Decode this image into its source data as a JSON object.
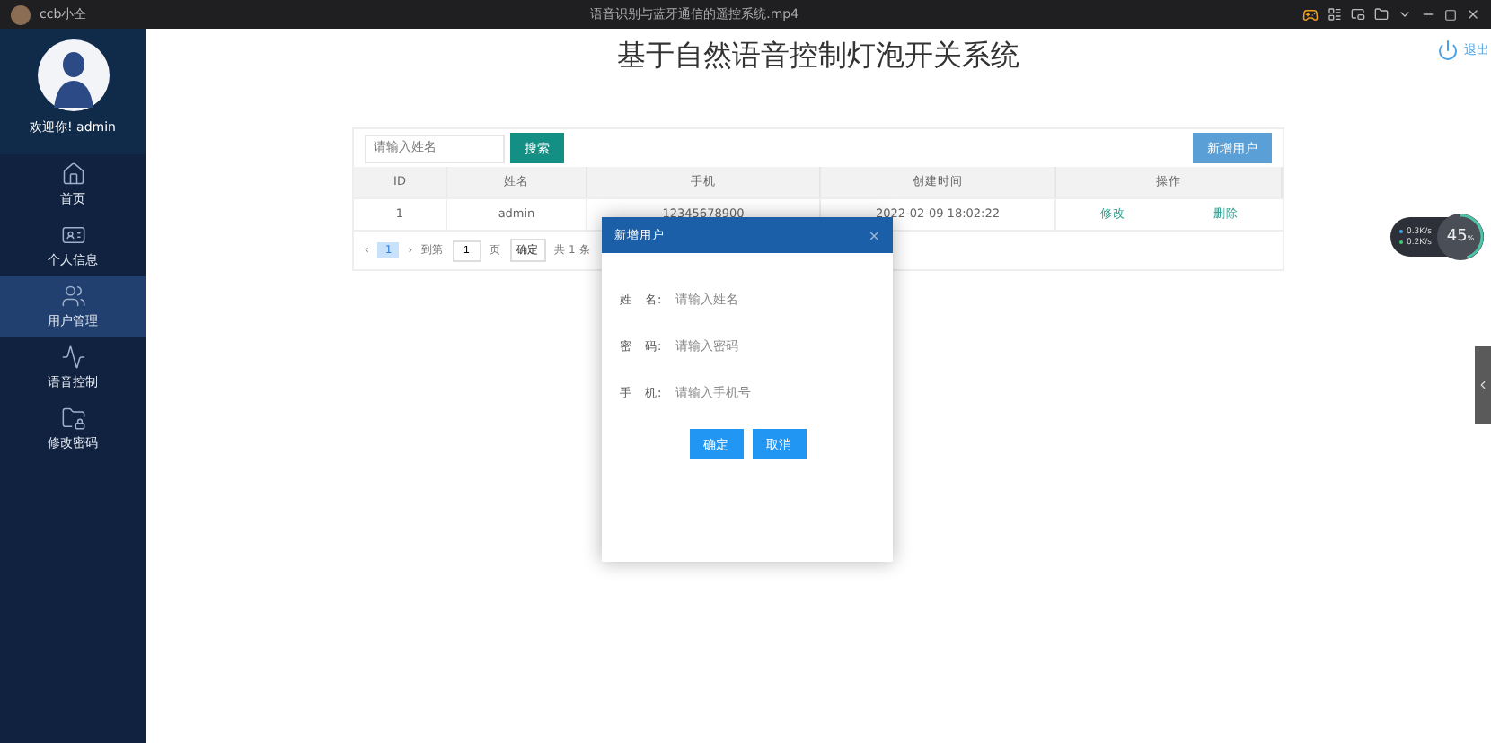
{
  "player": {
    "user": "ccb小仝",
    "title": "语音识别与蓝牙通信的遥控系统.mp4"
  },
  "app": {
    "title": "基于自然语音控制灯泡开关系统",
    "logout": "退出",
    "welcome": "欢迎你! admin"
  },
  "sidebar": {
    "items": [
      {
        "label": "首页",
        "selected": false
      },
      {
        "label": "个人信息",
        "selected": false
      },
      {
        "label": "用户管理",
        "selected": true
      },
      {
        "label": "语音控制",
        "selected": false
      },
      {
        "label": "修改密码",
        "selected": false
      }
    ]
  },
  "search": {
    "placeholder": "请输入姓名",
    "button": "搜索"
  },
  "add_button": "新增用户",
  "table": {
    "columns": [
      "ID",
      "姓名",
      "手机",
      "创建时间",
      "操作"
    ],
    "rows": [
      {
        "id": "1",
        "name": "admin",
        "phone": "12345678900",
        "created": "2022-02-09 18:02:22",
        "actions": [
          "修改",
          "删除"
        ]
      }
    ]
  },
  "pagination": {
    "prev": "‹",
    "pages": [
      {
        "label": "1",
        "selected": true
      }
    ],
    "next": "›",
    "goto": "到第",
    "page_value": "1",
    "page_unit": "页",
    "confirm": "确定",
    "total": "共 1 条"
  },
  "dialog": {
    "title": "新增用户",
    "close": "×",
    "fields": [
      {
        "label": "姓　名:",
        "placeholder": "请输入姓名"
      },
      {
        "label": "密　码:",
        "placeholder": "请输入密码"
      },
      {
        "label": "手　机:",
        "placeholder": "请输入手机号"
      }
    ],
    "buttons": [
      "确定",
      "取消"
    ]
  },
  "net_widget": {
    "up": "0.3",
    "up_unit": "K/s",
    "down": "0.2",
    "down_unit": "K/s",
    "percent": "45",
    "percent_unit": "%",
    "level": 0.45
  }
}
